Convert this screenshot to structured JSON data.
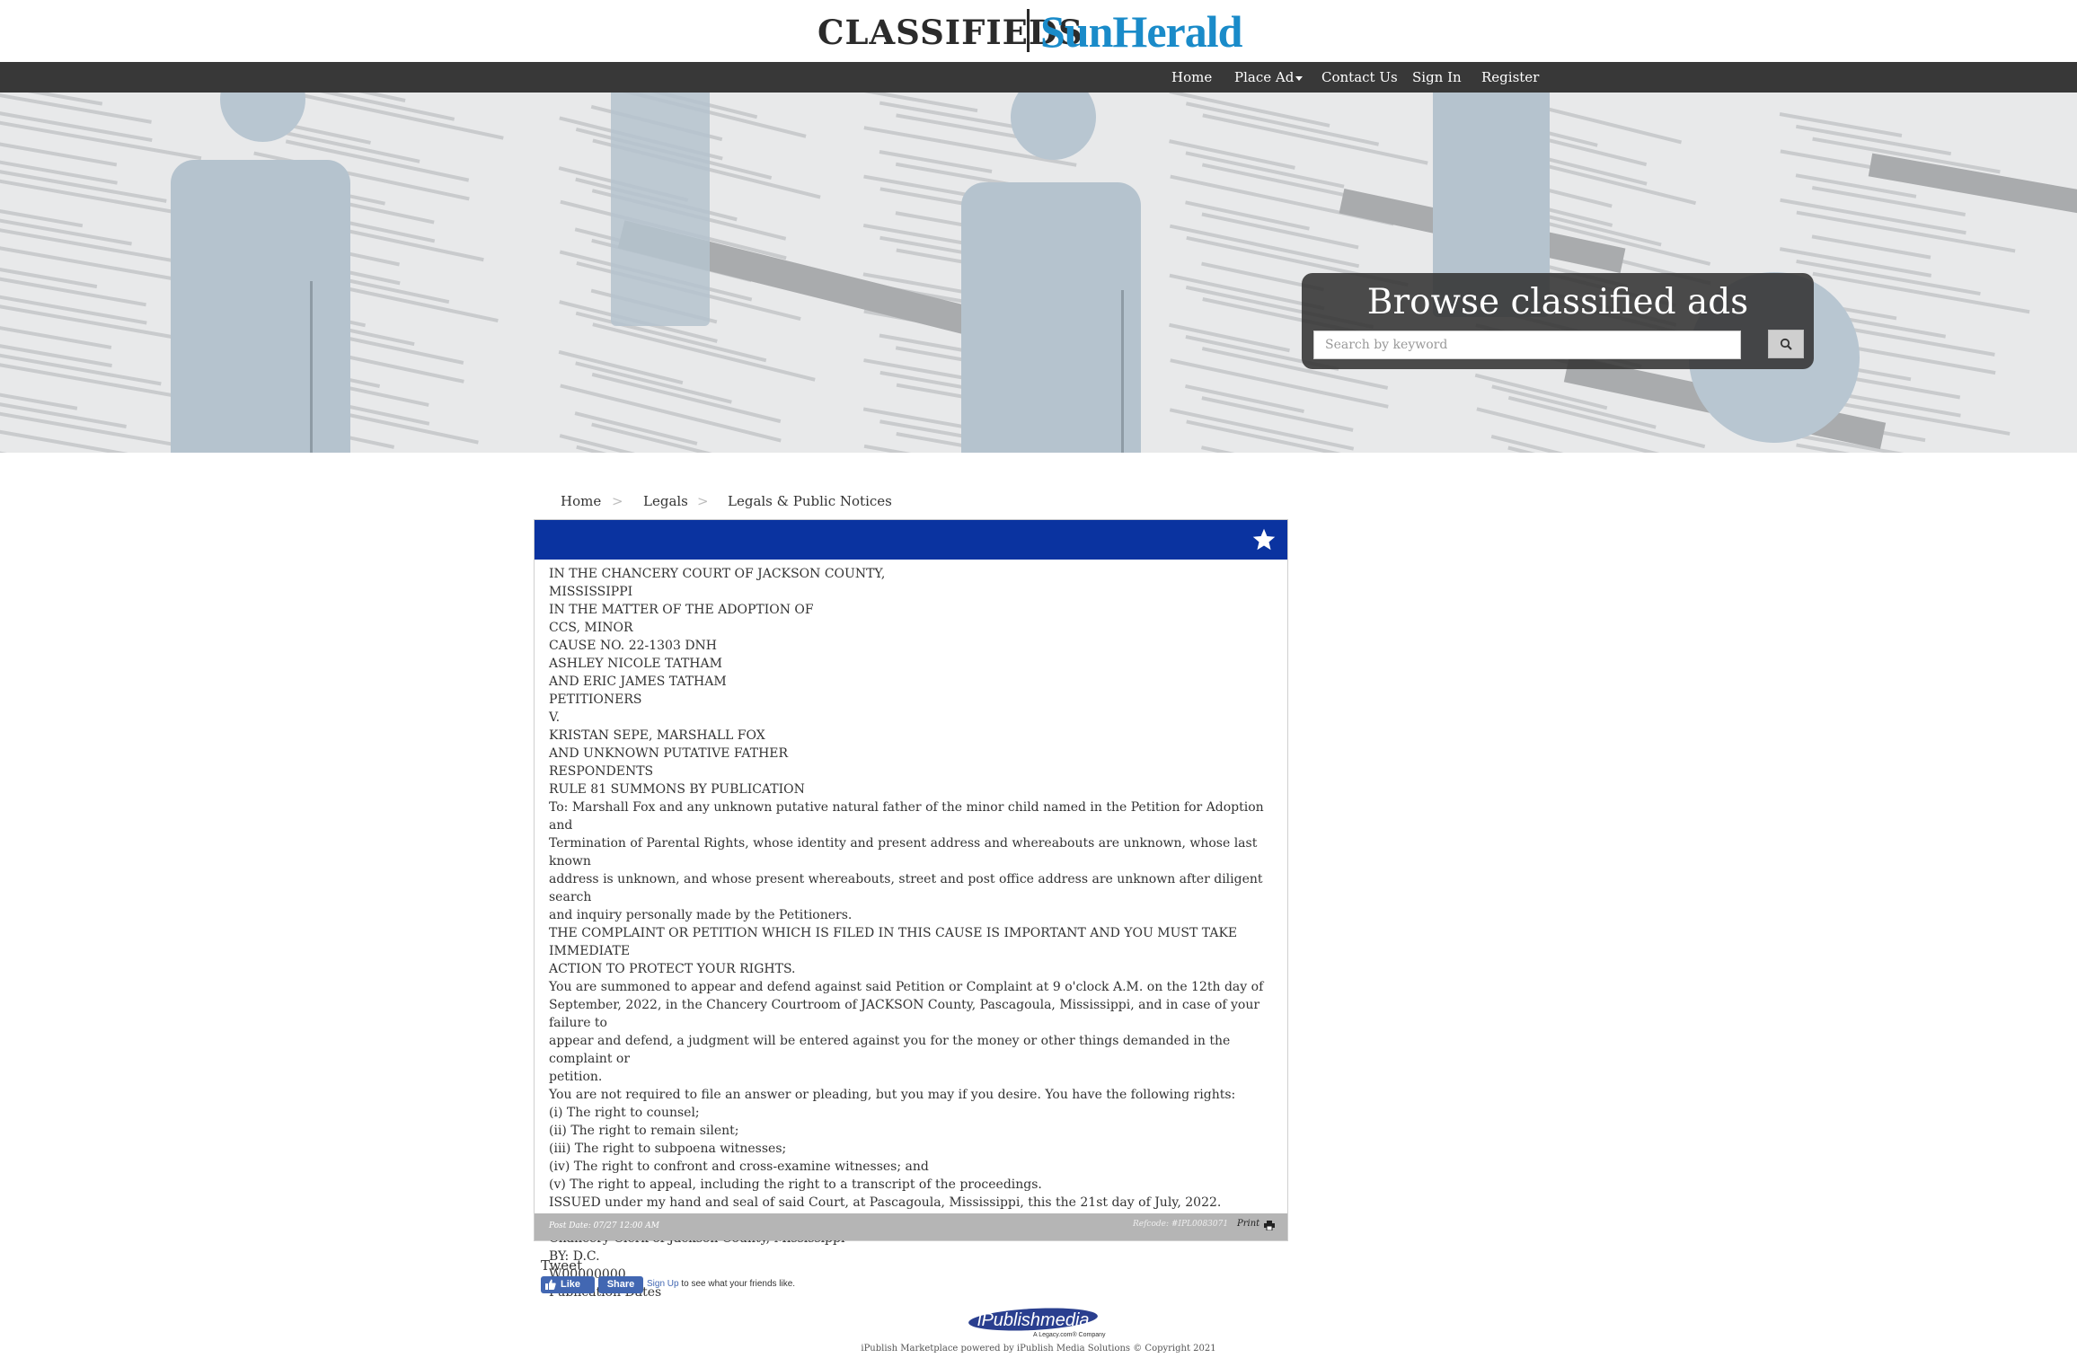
{
  "header": {
    "classifieds_label": "CLASSIFIEDS",
    "brand_name": "SunHerald"
  },
  "nav": {
    "items": [
      {
        "label": "Home"
      },
      {
        "label": "Place Ad"
      },
      {
        "label": "Contact Us"
      },
      {
        "label": "Sign In"
      },
      {
        "label": "Register"
      }
    ]
  },
  "hero": {
    "title": "Browse classified ads",
    "search_placeholder": "Search by keyword",
    "search_icon": "search-icon"
  },
  "breadcrumb": {
    "items": [
      "Home",
      "Legals",
      "Legals & Public Notices"
    ],
    "separator": ">"
  },
  "listing": {
    "header_color": "#0a33a0",
    "favorite_icon": "star-icon",
    "lines": [
      "IN THE CHANCERY COURT OF JACKSON COUNTY,",
      "MISSISSIPPI",
      "IN THE MATTER OF THE ADOPTION OF",
      "CCS, MINOR",
      "CAUSE NO. 22-1303 DNH",
      "ASHLEY NICOLE TATHAM",
      "AND ERIC JAMES TATHAM",
      "PETITIONERS",
      "V.",
      "KRISTAN SEPE, MARSHALL FOX",
      "AND UNKNOWN PUTATIVE FATHER",
      "RESPONDENTS",
      "RULE 81 SUMMONS BY PUBLICATION",
      "To: Marshall Fox and any unknown putative natural father of the minor child named in the Petition for Adoption and",
      "Termination of Parental Rights, whose identity and present address and whereabouts are unknown, whose last known",
      "address is unknown, and whose present whereabouts, street and post office address are unknown after diligent search",
      "and inquiry personally made by the Petitioners.",
      "THE COMPLAINT OR PETITION WHICH IS FILED IN THIS CAUSE IS IMPORTANT AND YOU MUST TAKE IMMEDIATE",
      "ACTION TO PROTECT YOUR RIGHTS.",
      "You are summoned to appear and defend against said Petition or Complaint at 9 o'clock A.M. on the 12th day of",
      "September, 2022, in the Chancery Courtroom of JACKSON County, Pascagoula, Mississippi, and in case of your failure to",
      "appear and defend, a judgment will be entered against you for the money or other things demanded in the complaint or",
      "petition.",
      "You are not required to file an answer or pleading, but you may if you desire. You have the following rights:",
      "(i) The right to counsel;",
      "(ii) The right to remain silent;",
      "(iii) The right to subpoena witnesses;",
      "(iv) The right to confront and cross-examine witnesses; and",
      "(v) The right to appeal, including the right to a transcript of the proceedings.",
      "ISSUED under my hand and seal of said Court, at Pascagoula, Mississippi, this the 21st day of July, 2022.",
      "",
      "Chancery Clerk of Jackson County, Mississippi",
      "BY: D.C.",
      "W00000000",
      "Publication Dates"
    ],
    "post_date": "Post Date: 07/27 12:00 AM",
    "refcode": "Refcode: #IPL0083071",
    "print_label": "Print"
  },
  "social": {
    "tweet_label": "Tweet",
    "like_label": "Like",
    "share_label": "Share",
    "signup_link": "Sign Up",
    "signup_text": "to see what your friends like."
  },
  "footer": {
    "logo_main": "iPublishmedia",
    "logo_sub": "A Legacy.com® Company",
    "copyright": "iPublish Marketplace powered by iPublish Media Solutions © Copyright 2021"
  }
}
